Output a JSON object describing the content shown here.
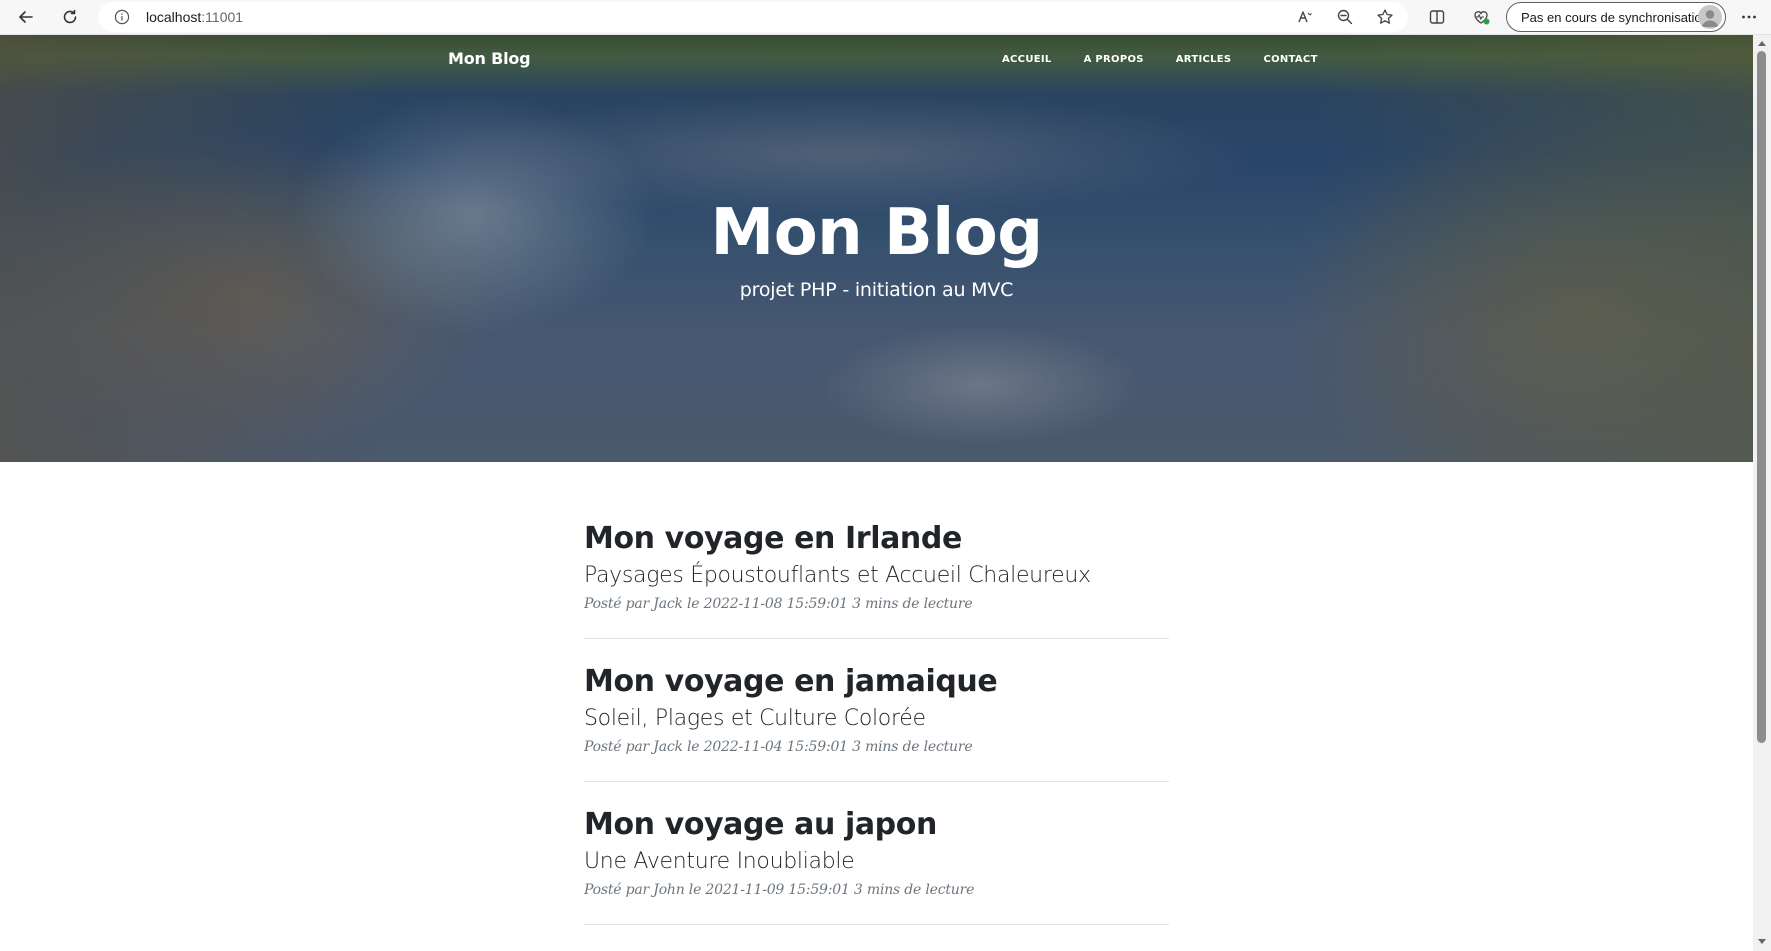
{
  "browser": {
    "url_host": "localhost",
    "url_port": ":11001",
    "sync_label": "Pas en cours de synchronisation"
  },
  "nav": {
    "brand": "Mon Blog",
    "links": [
      "Accueil",
      "A propos",
      "Articles",
      "Contact"
    ]
  },
  "hero": {
    "title": "Mon Blog",
    "subtitle": "projet PHP - initiation au MVC"
  },
  "posts": [
    {
      "title": "Mon voyage en Irlande",
      "subtitle": "Paysages Époustouflants et Accueil Chaleureux",
      "meta": "Posté par Jack le 2022-11-08 15:59:01 3 mins de lecture"
    },
    {
      "title": "Mon voyage en jamaique",
      "subtitle": "Soleil, Plages et Culture Colorée",
      "meta": "Posté par Jack le 2022-11-04 15:59:01 3 mins de lecture"
    },
    {
      "title": "Mon voyage au japon",
      "subtitle": "Une Aventure Inoubliable",
      "meta": "Posté par John le 2021-11-09 15:59:01 3 mins de lecture"
    }
  ],
  "icons": {
    "back": "back-arrow-icon",
    "refresh": "refresh-icon",
    "info": "info-icon",
    "read_aloud": "read-aloud-icon",
    "zoom": "zoom-out-icon",
    "favorite": "star-icon",
    "split": "split-screen-icon",
    "extensions": "browser-essentials-icon",
    "profile": "profile-avatar-icon",
    "more": "more-icon"
  }
}
